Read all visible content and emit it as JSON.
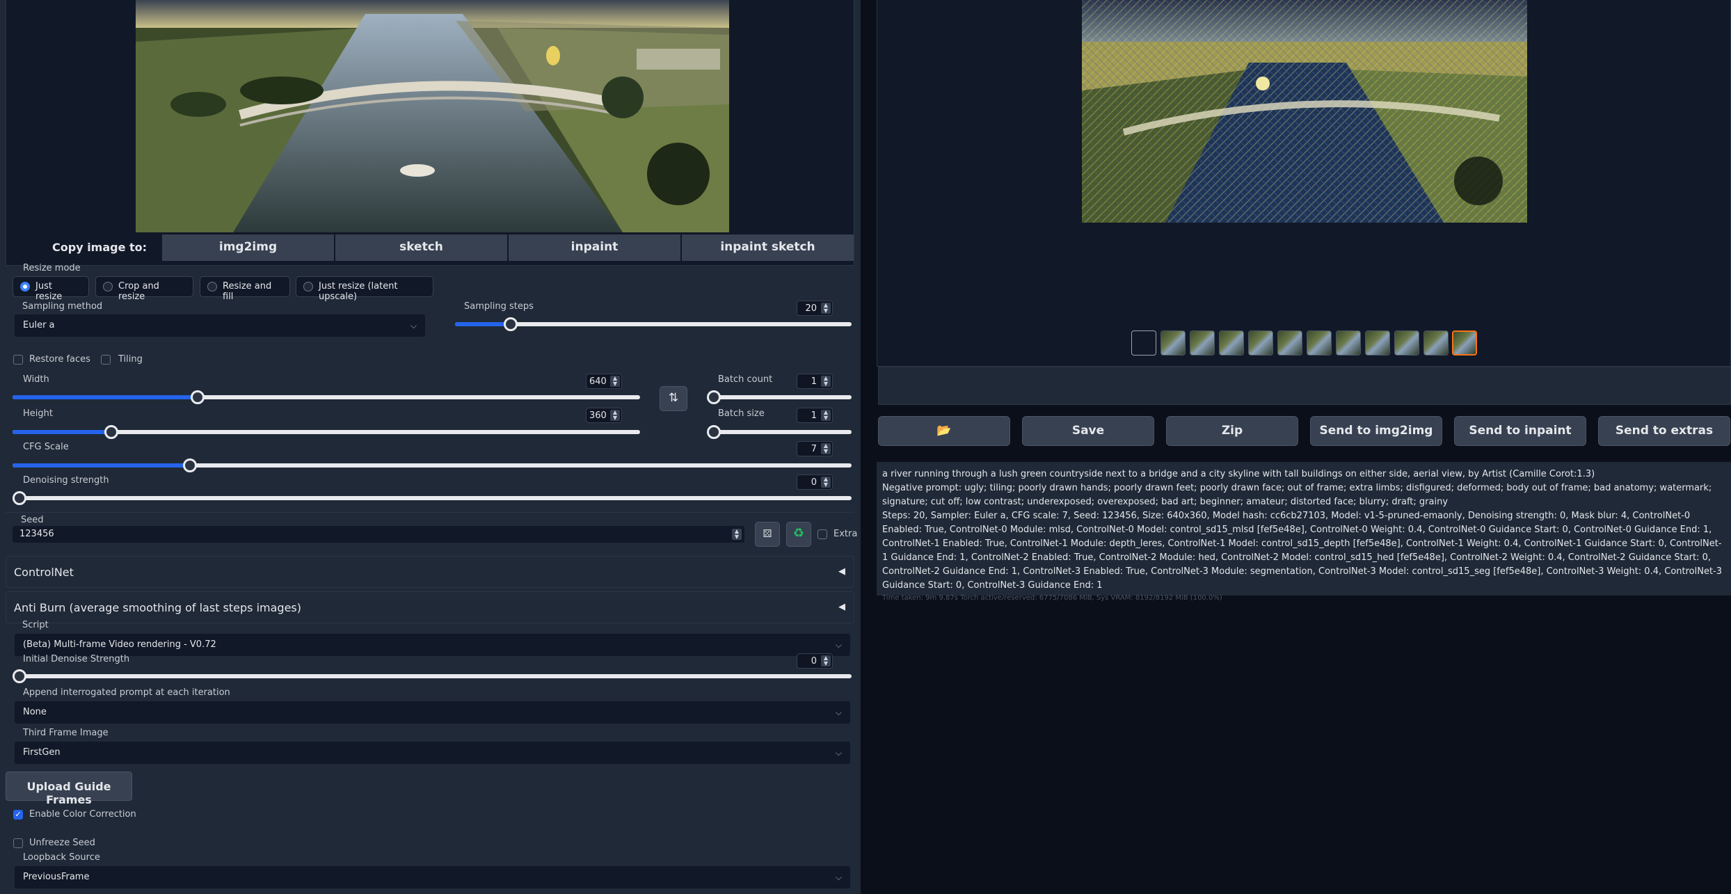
{
  "copy_image": {
    "label": "Copy image to:",
    "tabs": [
      "img2img",
      "sketch",
      "inpaint",
      "inpaint sketch"
    ]
  },
  "resize": {
    "label": "Resize mode",
    "options": [
      "Just resize",
      "Crop and resize",
      "Resize and fill",
      "Just resize (latent upscale)"
    ],
    "selected": "Just resize"
  },
  "sampling": {
    "method_label": "Sampling method",
    "method_value": "Euler a",
    "steps_label": "Sampling steps",
    "steps_value": "20",
    "steps": 20,
    "steps_max": 150
  },
  "checks": {
    "restore_faces": "Restore faces",
    "tiling": "Tiling"
  },
  "width": {
    "label": "Width",
    "value": "640",
    "v": 640,
    "max": 2048
  },
  "height": {
    "label": "Height",
    "value": "360",
    "v": 360,
    "max": 2048
  },
  "batch_count": {
    "label": "Batch count",
    "value": "1"
  },
  "batch_size": {
    "label": "Batch size",
    "value": "1"
  },
  "cfg": {
    "label": "CFG Scale",
    "value": "7",
    "v": 7,
    "max": 30
  },
  "denoise": {
    "label": "Denoising strength",
    "value": "0"
  },
  "seed": {
    "label": "Seed",
    "value": "123456",
    "extra": "Extra"
  },
  "accordions": {
    "controlnet": "ControlNet",
    "antiburn": "Anti Burn (average smoothing of last steps images)"
  },
  "script": {
    "label": "Script",
    "value": "(Beta) Multi-frame Video rendering - V0.72"
  },
  "init_denoise": {
    "label": "Initial Denoise Strength",
    "value": "0"
  },
  "append_prompt": {
    "label": "Append interrogated prompt at each iteration",
    "value": "None"
  },
  "third_frame": {
    "label": "Third Frame Image",
    "value": "FirstGen"
  },
  "upload_button": "Upload Guide Frames",
  "color_correction": "Enable Color Correction",
  "unfreeze_seed": "Unfreeze Seed",
  "loopback": {
    "label": "Loopback Source",
    "value": "PreviousFrame"
  },
  "actions": {
    "folder": "folder",
    "save": "Save",
    "zip": "Zip",
    "send_img2img": "Send to img2img",
    "send_inpaint": "Send to inpaint",
    "send_extras": "Send to extras"
  },
  "info": {
    "prompt": "a river running through a lush green countryside next to a bridge and a city skyline with tall buildings on either side, aerial view, by Artist (Camille Corot:1.3)",
    "negative": "Negative prompt: ugly; tiling; poorly drawn hands; poorly drawn feet; poorly drawn face; out of frame; extra limbs; disfigured; deformed; body out of frame; bad anatomy; watermark; signature; cut off; low contrast; underexposed; overexposed; bad art; beginner; amateur; distorted face; blurry; draft; grainy",
    "params": "Steps: 20, Sampler: Euler a, CFG scale: 7, Seed: 123456, Size: 640x360, Model hash: cc6cb27103, Model: v1-5-pruned-emaonly, Denoising strength: 0, Mask blur: 4, ControlNet-0 Enabled: True, ControlNet-0 Module: mlsd, ControlNet-0 Model: control_sd15_mlsd [fef5e48e], ControlNet-0 Weight: 0.4, ControlNet-0 Guidance Start: 0, ControlNet-0 Guidance End: 1, ControlNet-1 Enabled: True, ControlNet-1 Module: depth_leres, ControlNet-1 Model: control_sd15_depth [fef5e48e], ControlNet-1 Weight: 0.4, ControlNet-1 Guidance Start: 0, ControlNet-1 Guidance End: 1, ControlNet-2 Enabled: True, ControlNet-2 Module: hed, ControlNet-2 Model: control_sd15_hed [fef5e48e], ControlNet-2 Weight: 0.4, ControlNet-2 Guidance Start: 0, ControlNet-2 Guidance End: 1, ControlNet-3 Enabled: True, ControlNet-3 Module: segmentation, ControlNet-3 Model: control_sd15_seg [fef5e48e], ControlNet-3 Weight: 0.4, ControlNet-3 Guidance Start: 0, ControlNet-3 Guidance End: 1",
    "timing": "Time taken: 9m 9.87s  Torch active/reserved: 6775/7086 MiB, Sys VRAM: 8192/8192 MiB (100.0%)"
  },
  "colors": {
    "accent": "#2563eb",
    "selected_thumb": "#f97316"
  }
}
